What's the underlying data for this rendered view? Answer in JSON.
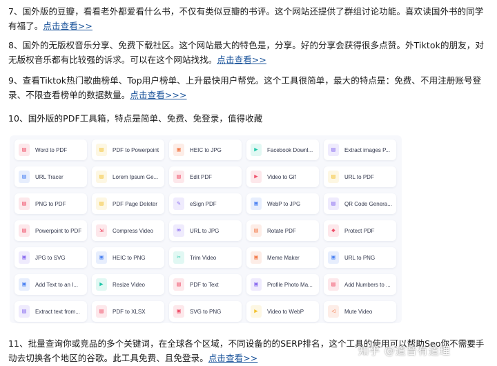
{
  "paragraphs": [
    {
      "text": "7、国外版的豆瓣，看看老外都爱看什么书，不仅有类似豆瓣的书评。这个网站还提供了群组讨论功能。喜欢读国外书的同学有福了。",
      "link": "点击查看>>"
    },
    {
      "text": "8、国外的无版权音乐分享、免费下载社区。这个网站最大的特色是，分享。好的分享会获得很多点赞。外Tiktok的朋友，对无版权音乐都有比较强的诉求。可以在这个网站找找。",
      "link": "点击查看>>"
    },
    {
      "text": "9、查看Tiktok热门歌曲榜单、Top用户榜单、上升最快用户帮党。这个工具很简单，最大的特点是：免费、不用注册账号登录、不限查看榜单的数据数量。",
      "link": "点击查看>>>"
    },
    {
      "text": "10、国外版的PDF工具箱，特点是简单、免费、免登录，值得收藏",
      "link": ""
    },
    {
      "text": "11、批量查询你或竞品的多个关键词，在全球各个区域，不同设备的的SERP排名，这个工具的使用可以帮助Seo你不需要手动去切换各个地区的谷歌。此工具免费、且免登录。",
      "link": "点击查看>>"
    }
  ],
  "tools": [
    {
      "label": "Word to PDF",
      "icon": "document-icon",
      "color": "#ef4f6a"
    },
    {
      "label": "PDF to Powerpoint",
      "icon": "document-icon",
      "color": "#f2c230"
    },
    {
      "label": "HEIC to JPG",
      "icon": "image-icon",
      "color": "#f27b4b"
    },
    {
      "label": "Facebook Downl...",
      "icon": "video-icon",
      "color": "#1fc7a8"
    },
    {
      "label": "Extract images P...",
      "icon": "document-icon",
      "color": "#8a6cf0"
    },
    {
      "label": "URL Tracer",
      "icon": "document-icon",
      "color": "#4b82f2"
    },
    {
      "label": "Lorem Ipsum Ge...",
      "icon": "document-icon",
      "color": "#f2c230"
    },
    {
      "label": "Edit PDF",
      "icon": "document-icon",
      "color": "#ef4f6a"
    },
    {
      "label": "Video to Gif",
      "icon": "video-icon",
      "color": "#ef4f6a"
    },
    {
      "label": "URL to PDF",
      "icon": "document-icon",
      "color": "#f2c230"
    },
    {
      "label": "PNG to PDF",
      "icon": "document-icon",
      "color": "#ef4f6a"
    },
    {
      "label": "PDF Page Deleter",
      "icon": "document-icon",
      "color": "#f2c230"
    },
    {
      "label": "eSign PDF",
      "icon": "edit-icon",
      "color": "#8a6cf0"
    },
    {
      "label": "WebP to JPG",
      "icon": "image-icon",
      "color": "#4b82f2"
    },
    {
      "label": "QR Code Genera...",
      "icon": "document-icon",
      "color": "#8a6cf0"
    },
    {
      "label": "Powerpoint to PDF",
      "icon": "document-icon",
      "color": "#ef4f6a"
    },
    {
      "label": "Compress Video",
      "icon": "compress-icon",
      "color": "#ef4f6a"
    },
    {
      "label": "URL to JPG",
      "icon": "link-icon",
      "color": "#8a6cf0"
    },
    {
      "label": "Rotate PDF",
      "icon": "document-icon",
      "color": "#f27b4b"
    },
    {
      "label": "Protect PDF",
      "icon": "lock-icon",
      "color": "#ef4f6a"
    },
    {
      "label": "JPG to SVG",
      "icon": "image-icon",
      "color": "#8a6cf0"
    },
    {
      "label": "HEIC to PNG",
      "icon": "image-icon",
      "color": "#4b82f2"
    },
    {
      "label": "Trim Video",
      "icon": "scissors-icon",
      "color": "#1fc7a8"
    },
    {
      "label": "Meme Maker",
      "icon": "image-icon",
      "color": "#f27b4b"
    },
    {
      "label": "URL to PNG",
      "icon": "image-icon",
      "color": "#4b82f2"
    },
    {
      "label": "Add Text to an I...",
      "icon": "image-icon",
      "color": "#4b82f2"
    },
    {
      "label": "Resize Video",
      "icon": "video-icon",
      "color": "#1fc7a8"
    },
    {
      "label": "PDF to Text",
      "icon": "document-icon",
      "color": "#ef4f6a"
    },
    {
      "label": "Profile Photo Ma...",
      "icon": "image-icon",
      "color": "#8a6cf0"
    },
    {
      "label": "Add Numbers to ...",
      "icon": "document-icon",
      "color": "#ef4f6a"
    },
    {
      "label": "Extract text from...",
      "icon": "document-icon",
      "color": "#8a6cf0"
    },
    {
      "label": "PDF to XLSX",
      "icon": "document-icon",
      "color": "#ef4f6a"
    },
    {
      "label": "SVG to PNG",
      "icon": "image-icon",
      "color": "#ef4f6a"
    },
    {
      "label": "Video to WebP",
      "icon": "video-icon",
      "color": "#f2c230"
    },
    {
      "label": "Mute Video",
      "icon": "mute-icon",
      "color": "#f27b4b"
    }
  ],
  "watermark": "知乎 @道音有道理"
}
